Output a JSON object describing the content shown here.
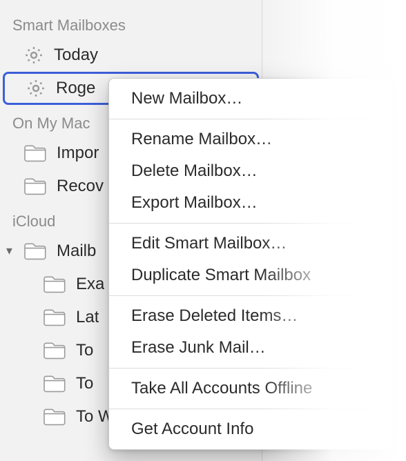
{
  "sidebar": {
    "sections": [
      {
        "id": "smart",
        "headerLabel": "Smart Mailboxes",
        "items": [
          {
            "label": "Today",
            "icon": "gear",
            "selected": false,
            "nested": false,
            "disclosure": false
          },
          {
            "label": "Roge",
            "icon": "gear",
            "selected": true,
            "nested": false,
            "disclosure": false
          }
        ]
      },
      {
        "id": "onmymac",
        "headerLabel": "On My Mac",
        "items": [
          {
            "label": "Impor",
            "icon": "folder",
            "selected": false,
            "nested": false,
            "disclosure": false
          },
          {
            "label": "Recov",
            "icon": "folder",
            "selected": false,
            "nested": false,
            "disclosure": false
          }
        ]
      },
      {
        "id": "icloud",
        "headerLabel": "iCloud",
        "items": [
          {
            "label": "Mailb",
            "icon": "folder",
            "selected": false,
            "nested": false,
            "disclosure": true
          },
          {
            "label": "Exa",
            "icon": "folder",
            "selected": false,
            "nested": true,
            "disclosure": false
          },
          {
            "label": "Lat",
            "icon": "folder",
            "selected": false,
            "nested": true,
            "disclosure": false
          },
          {
            "label": "To",
            "icon": "folder",
            "selected": false,
            "nested": true,
            "disclosure": false
          },
          {
            "label": "To",
            "icon": "folder",
            "selected": false,
            "nested": true,
            "disclosure": false
          },
          {
            "label": "To Watch",
            "icon": "folder",
            "selected": false,
            "nested": true,
            "disclosure": false
          }
        ]
      }
    ]
  },
  "contextMenu": {
    "groups": [
      [
        {
          "label": "New Mailbox…"
        }
      ],
      [
        {
          "label": "Rename Mailbox…"
        },
        {
          "label": "Delete Mailbox…"
        },
        {
          "label": "Export Mailbox…"
        }
      ],
      [
        {
          "label": "Edit Smart Mailbox…"
        },
        {
          "label": "Duplicate Smart Mailbox"
        }
      ],
      [
        {
          "label": "Erase Deleted Items…"
        },
        {
          "label": "Erase Junk Mail…"
        }
      ],
      [
        {
          "label": "Take All Accounts Offline"
        }
      ],
      [
        {
          "label": "Get Account Info"
        }
      ]
    ]
  }
}
